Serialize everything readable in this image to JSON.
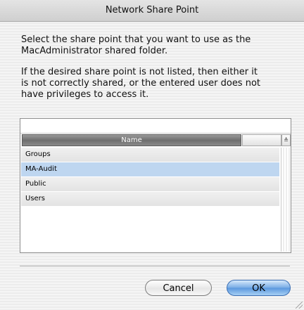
{
  "dialog": {
    "title": "Network Share Point",
    "message_1": "Select the share point that you want to use as the\nMacAdministrator shared folder.",
    "message_2": "If the desired share point is not listed, then either it\nis not correctly shared, or the entered user does not\nhave privileges to access it."
  },
  "table": {
    "column_name": "Name",
    "sort_glyph": "≜",
    "rows": [
      {
        "name": "Groups",
        "selected": false
      },
      {
        "name": "MA-Audit",
        "selected": true
      },
      {
        "name": "Public",
        "selected": false
      },
      {
        "name": "Users",
        "selected": false
      }
    ]
  },
  "buttons": {
    "cancel": "Cancel",
    "ok": "OK"
  },
  "colors": {
    "selection": "#bed6f0",
    "default_button": "#5a97de"
  }
}
